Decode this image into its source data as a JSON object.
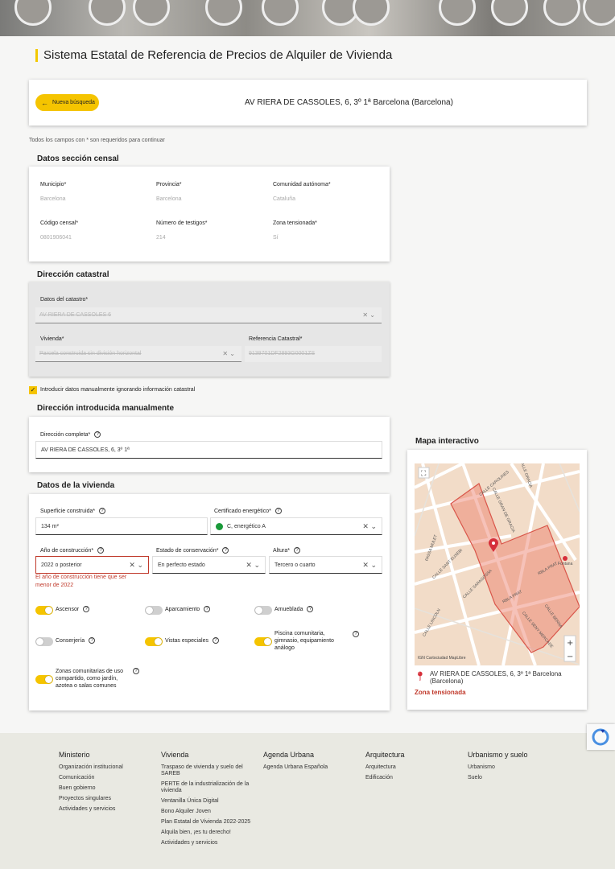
{
  "header": {
    "title": "Sistema Estatal de Referencia de Precios de Alquiler de Vivienda"
  },
  "search": {
    "back_label": "Nueva búsqueda",
    "address": "AV RIERA DE CASSOLES, 6, 3º 1ª Barcelona (Barcelona)"
  },
  "required_note": "Todos los campos con * son requeridos para continuar",
  "censal": {
    "title": "Datos sección censal",
    "municipio_label": "Municipio*",
    "municipio": "Barcelona",
    "provincia_label": "Provincia*",
    "provincia": "Barcelona",
    "comunidad_label": "Comunidad autónoma*",
    "comunidad": "Cataluña",
    "codigo_label": "Código censal*",
    "codigo": "0801906041",
    "testigos_label": "Número de testigos*",
    "testigos": "214",
    "zona_label": "Zona tensionada*",
    "zona": "Sí"
  },
  "catastral": {
    "title": "Dirección catastral",
    "datos_label": "Datos del catastro*",
    "datos": "AV RIERA DE CASSOLES 6",
    "vivienda_label": "Vivienda*",
    "vivienda": "Parcela construida sin división horizontal",
    "ref_label": "Referencia Catastral*",
    "ref": "9139701DF2893G0001ZS"
  },
  "manual_check_label": "Introducir datos manualmente ignorando información catastral",
  "manual": {
    "title": "Dirección introducida manualmente",
    "dir_label": "Dirección completa*",
    "dir": "AV RIERA DE CASSOLES, 6, 3º 1ª"
  },
  "vivienda": {
    "title": "Datos de la vivienda",
    "superficie_label": "Superficie construida*",
    "superficie": "134  m²",
    "cert_label": "Certificado energético*",
    "cert": "C, energético A",
    "anio_label": "Año de construcción*",
    "anio": "2022 o posterior",
    "estado_label": "Estado de conservación*",
    "estado": "En perfecto estado",
    "altura_label": "Altura*",
    "altura": "Tercero o cuarto",
    "anio_error": "El año de construcción tiene que ser menor de 2022",
    "toggles": [
      {
        "label": "Ascensor",
        "on": true
      },
      {
        "label": "Aparcamiento",
        "on": false
      },
      {
        "label": "Amueblada",
        "on": false
      },
      {
        "label": "Conserjería",
        "on": false
      },
      {
        "label": "Vistas especiales",
        "on": true
      },
      {
        "label": "Piscina comunitaria, gimnasio, equipamiento análogo",
        "on": true
      },
      {
        "label": "Zonas comunitarias de uso compartido, como jardín, azotea o salas comunes",
        "on": true
      }
    ]
  },
  "map": {
    "title": "Mapa interactivo",
    "address": "AV RIERA DE CASSOLES, 6, 3º 1ª Barcelona (Barcelona)",
    "zona": "Zona tensionada",
    "attribution": "IGN  Cartociudad  MapLibre",
    "streets": {
      "caroline": "CALLE CAROLINES",
      "grecia": "CALLE GRACIA",
      "gran": "CALLE GRAN DE GRACIA",
      "mulet": "PASSA MULET",
      "euebi": "CALLE SANT EUSEBI",
      "bairragosa": "CALLE SARAGOSSA",
      "rbla": "RBLA PRAT",
      "rbla2": "RBLA PRAT",
      "lincoln": "CALLE LINCOLN",
      "merc": "CALLE SENY MERCADE",
      "berna": "CALLE BERNA",
      "fontana": "Fontana"
    }
  },
  "footer": {
    "cols": [
      {
        "title": "Ministerio",
        "items": [
          "Organización institucional",
          "Comunicación",
          "Buen gobierno",
          "Proyectos singulares",
          "Actividades y servicios"
        ]
      },
      {
        "title": "Vivienda",
        "items": [
          "Traspaso de vivienda y suelo del SAREB",
          "PERTE de la industrialización de la vivienda",
          "Ventanilla Única Digital",
          "Bono Alquiler Joven",
          "Plan Estatal de Vivienda 2022-2025",
          "Alquila bien, ¡es tu derecho!",
          "Actividades y servicios"
        ]
      },
      {
        "title": "Agenda Urbana",
        "items": [
          "Agenda Urbana Española"
        ]
      },
      {
        "title": "Arquitectura",
        "items": [
          "Arquitectura",
          "Edificación"
        ]
      },
      {
        "title": "Urbanismo y suelo",
        "items": [
          "Urbanismo",
          "Suelo"
        ]
      }
    ]
  },
  "colors": {
    "accent": "#f5c400",
    "error": "#c0392b"
  }
}
